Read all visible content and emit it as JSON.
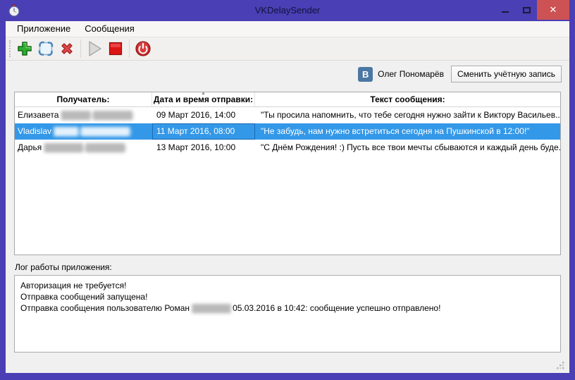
{
  "window": {
    "title": "VKDelaySender",
    "close_glyph": "✕"
  },
  "menu": {
    "items": [
      {
        "label": "Приложение"
      },
      {
        "label": "Сообщения"
      }
    ]
  },
  "toolbar": {
    "buttons": [
      {
        "name": "add",
        "icon": "green-plus-icon"
      },
      {
        "name": "edit",
        "icon": "selection-frame-icon"
      },
      {
        "name": "delete",
        "icon": "red-cross-icon"
      },
      {
        "name": "start-sending",
        "icon": "play-icon-disabled"
      },
      {
        "name": "stop-sending",
        "icon": "stop-icon"
      },
      {
        "name": "exit",
        "icon": "power-icon"
      }
    ]
  },
  "account": {
    "vk_badge": "В",
    "user_name": "Олег Пономарёв",
    "switch_button_label": "Сменить учётную запись"
  },
  "table": {
    "sort_indicator": "▲",
    "columns": [
      "Получатель:",
      "Дата и время отправки:",
      "Текст сообщения:"
    ],
    "rows": [
      {
        "recipient": "Елизавета",
        "recipient_censored": "██████ (████████)",
        "datetime": "09 Март 2016, 14:00",
        "message": "\"Ты просила напомнить, что тебе сегодня нужно зайти к Виктору Васильев...",
        "selected": false
      },
      {
        "recipient": "Vladislav",
        "recipient_censored": "█████ (██████████)",
        "datetime": "11 Март 2016, 08:00",
        "message": "\"Не забудь, нам нужно встретиться сегодня на Пушкинской в 12:00!\"",
        "selected": true
      },
      {
        "recipient": "Дарья",
        "recipient_censored": "████████ (████████)",
        "datetime": "13 Март 2016, 10:00",
        "message": "\"С Днём Рождения! :) Пусть все твои мечты сбываются и каждый день буде...",
        "selected": false
      }
    ]
  },
  "log": {
    "label": "Лог работы приложения:",
    "lines": [
      "Авторизация не требуется!",
      "Отправка сообщений запущена!",
      {
        "pre": "Отправка сообщения пользователю Роман ",
        "censored": "████████",
        "post": " 05.03.2016 в 10:42: сообщение успешно отправлено!"
      }
    ]
  },
  "colors": {
    "accent_purple": "#4a3fb4",
    "close_red": "#cd5254",
    "selection_blue": "#3498e8",
    "vk_blue": "#4b77a2"
  }
}
